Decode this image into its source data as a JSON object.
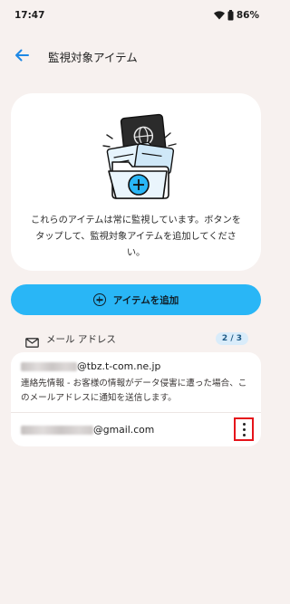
{
  "status_bar": {
    "time": "17:47",
    "battery": "86%",
    "icons": [
      "wifi-icon",
      "battery-icon"
    ]
  },
  "app_bar": {
    "back_icon": "arrow-back-icon",
    "title": "監視対象アイテム"
  },
  "hero": {
    "illustration": "passport-folder-add-illustration",
    "description": "これらのアイテムは常に監視しています。ボタンをタップして、監視対象アイテムを追加してください。"
  },
  "add_button": {
    "label": "アイテムを追加",
    "icon": "add-circle-icon"
  },
  "section": {
    "icon": "mail-icon",
    "label": "メール アドレス",
    "count": "2 / 3"
  },
  "emails": [
    {
      "address_visible": "@tbz.t-com.ne.jp",
      "description": "連絡先情報 - お客様の情報がデータ侵害に遭った場合、このメールアドレスに通知を送信します。"
    },
    {
      "address_visible": "@gmail.com",
      "menu_icon": "more-vert-icon"
    }
  ],
  "colors": {
    "background": "#f7f1ef",
    "accent": "#29b6f6",
    "badge_bg": "#d9ecfa",
    "highlight_border": "#e5141b"
  }
}
